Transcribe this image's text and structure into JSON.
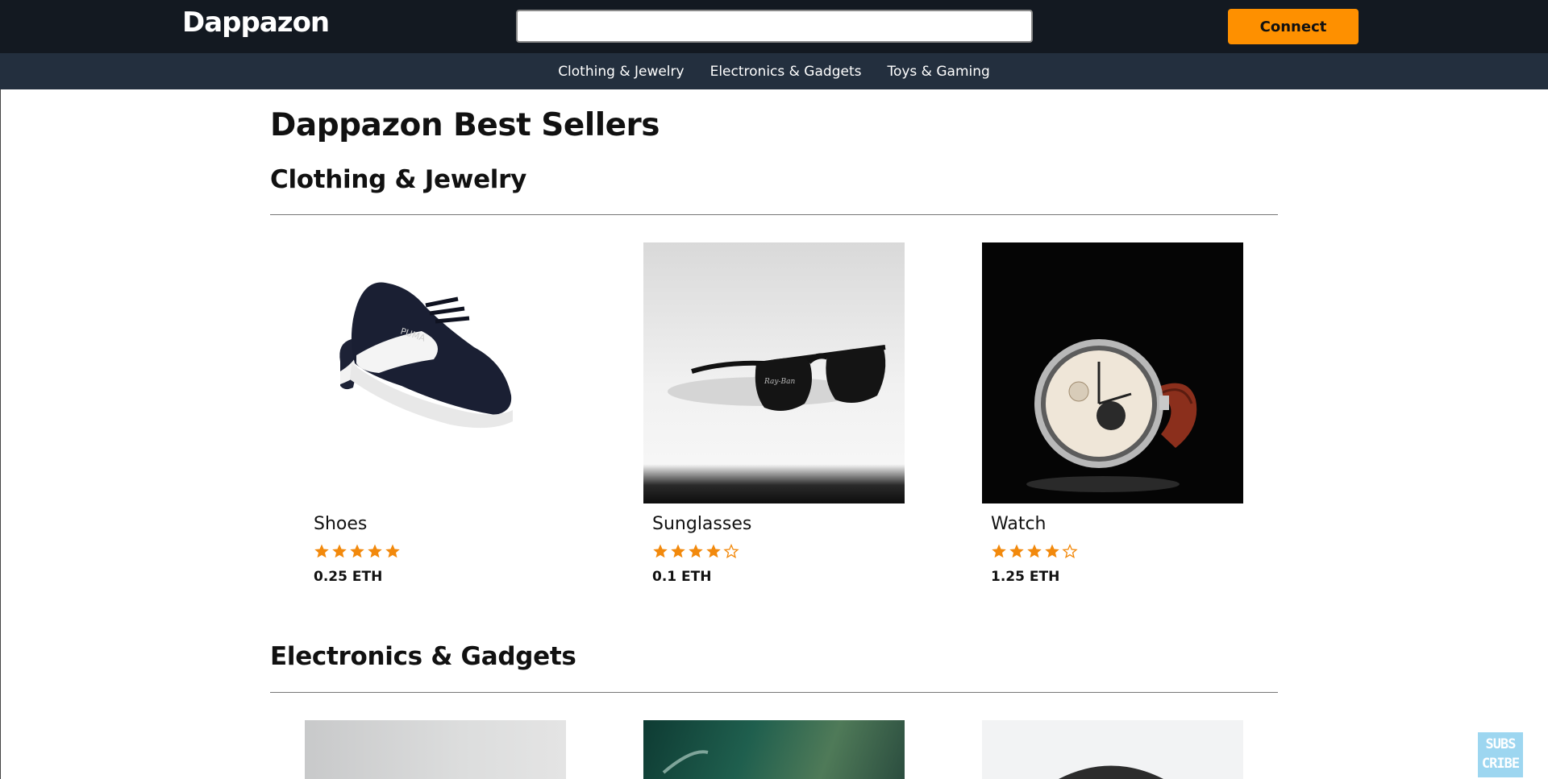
{
  "header": {
    "logo": "Dappazon",
    "search_placeholder": "",
    "connect_label": "Connect"
  },
  "nav": {
    "items": [
      "Clothing & Jewelry",
      "Electronics & Gadgets",
      "Toys & Gaming"
    ]
  },
  "main": {
    "page_title": "Dappazon Best Sellers",
    "sections": [
      {
        "title": "Clothing & Jewelry",
        "products": [
          {
            "name": "Shoes",
            "rating": 5,
            "price": "0.25 ETH"
          },
          {
            "name": "Sunglasses",
            "rating": 4,
            "price": "0.1 ETH"
          },
          {
            "name": "Watch",
            "rating": 4,
            "price": "1.25 ETH"
          }
        ]
      },
      {
        "title": "Electronics & Gadgets",
        "products": []
      }
    ]
  },
  "overlay": {
    "subscribe_line1": "SUBS",
    "subscribe_line2": "CRIBE"
  },
  "colors": {
    "topbar": "#131921",
    "subnav": "#232f3e",
    "accent": "#fe9000",
    "star": "#f2890c"
  }
}
